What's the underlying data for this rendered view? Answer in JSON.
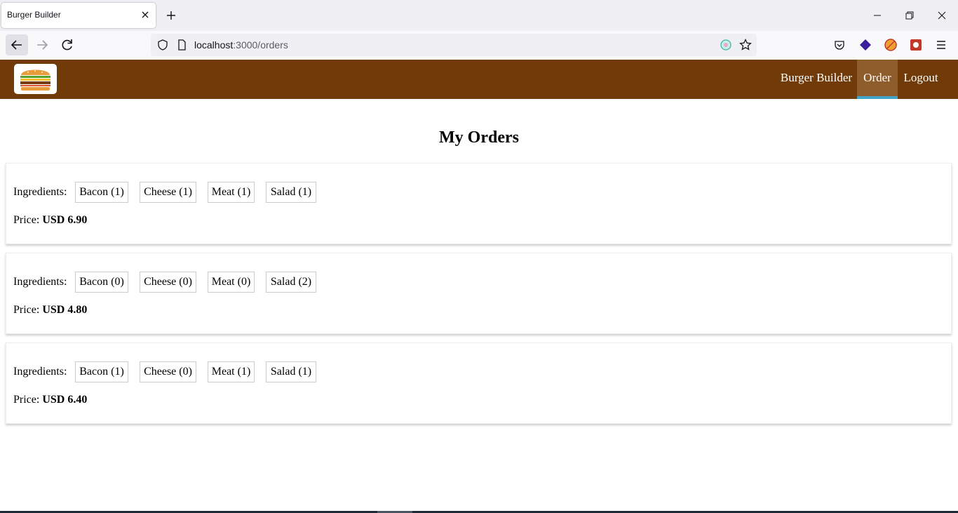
{
  "browser": {
    "tab_title": "Burger Builder",
    "url_host": "localhost",
    "url_path": ":3000/orders"
  },
  "toolbar": {
    "nav": [
      {
        "label": "Burger Builder",
        "active": false
      },
      {
        "label": "Order",
        "active": true
      },
      {
        "label": "Logout",
        "active": false
      }
    ],
    "colors": {
      "background": "#703b09",
      "active_bg": "#8f5c2c",
      "active_border": "#40a4c8"
    }
  },
  "page": {
    "title": "My Orders",
    "ingredients_label": "Ingredients:",
    "price_label": "Price:"
  },
  "orders": [
    {
      "ingredients": [
        "Bacon (1)",
        "Cheese (1)",
        "Meat (1)",
        "Salad (1)"
      ],
      "price": "USD 6.90"
    },
    {
      "ingredients": [
        "Bacon (0)",
        "Cheese (0)",
        "Meat (0)",
        "Salad (2)"
      ],
      "price": "USD 4.80"
    },
    {
      "ingredients": [
        "Bacon (1)",
        "Cheese (0)",
        "Meat (1)",
        "Salad (1)"
      ],
      "price": "USD 6.40"
    }
  ]
}
